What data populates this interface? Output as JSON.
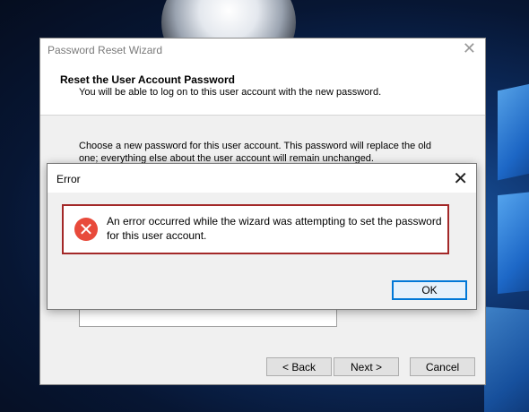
{
  "wizard": {
    "title": "Password Reset Wizard",
    "close_glyph": "✕",
    "header_title": "Reset the User Account Password",
    "header_subtitle": "You will be able to log on to this user account with the new password.",
    "description": "Choose a new password for this user account. This password will replace the old one; everything else about the user account will remain unchanged.",
    "password_value": "",
    "buttons": {
      "back": "< Back",
      "next": "Next >",
      "cancel": "Cancel"
    }
  },
  "error_dialog": {
    "title": "Error",
    "close_glyph": "✕",
    "icon": "error-x-icon",
    "message": "An error occurred while the wizard was attempting to set the password for this user account.",
    "ok_label": "OK"
  },
  "colors": {
    "accent": "#0078d7",
    "error_border": "#a32828",
    "error_icon": "#e84a3b"
  }
}
